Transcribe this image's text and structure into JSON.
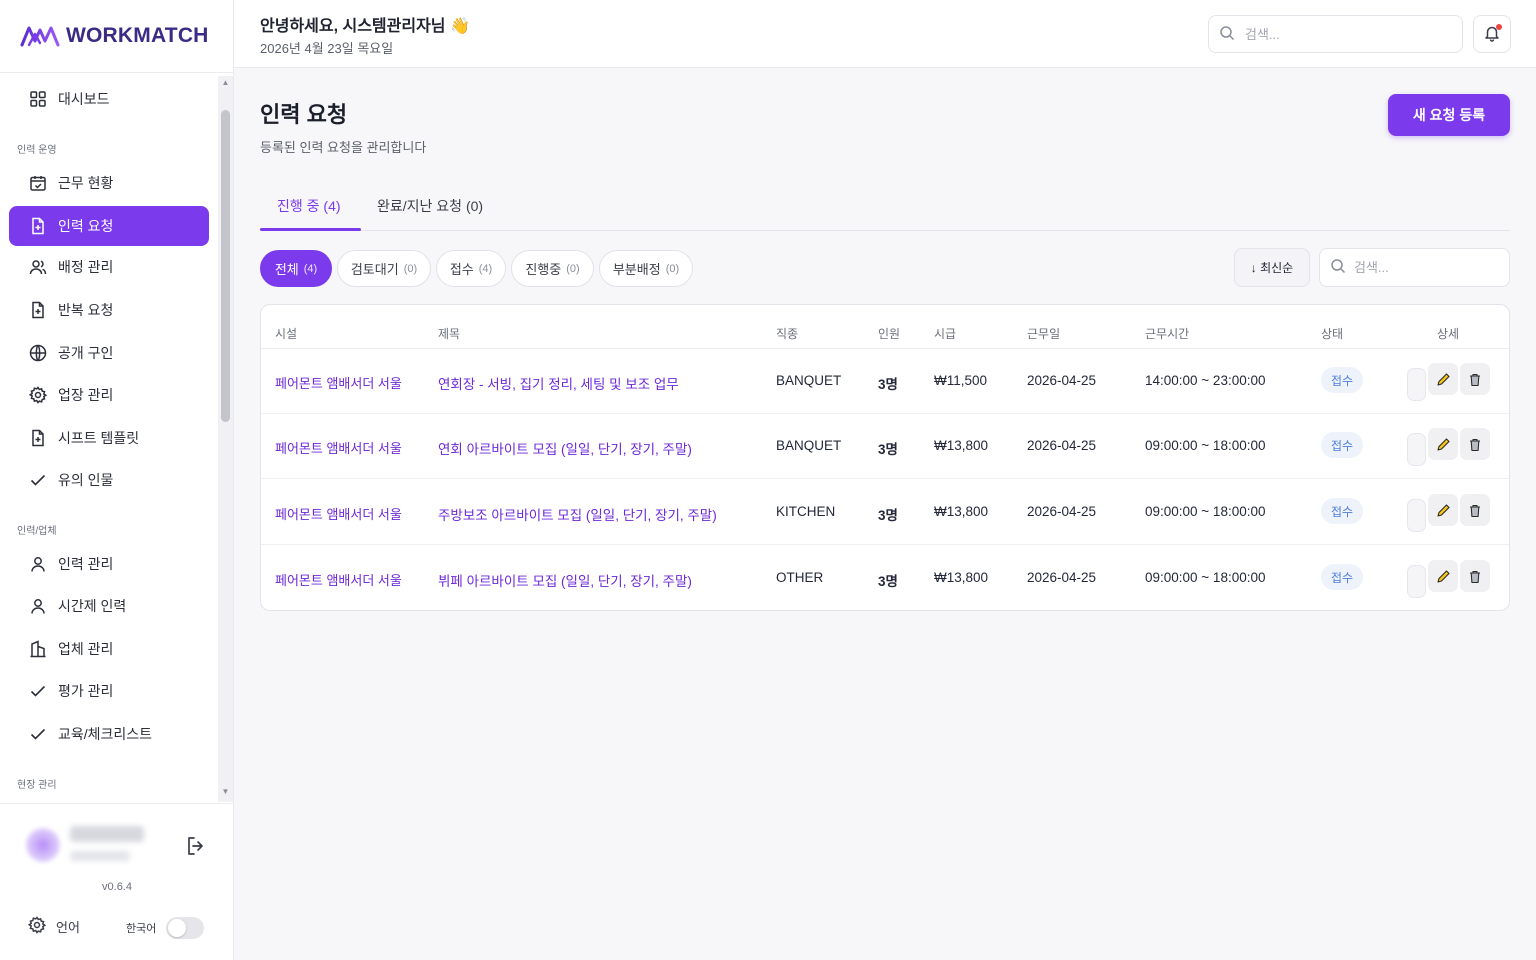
{
  "brand": {
    "name": "WORKMATCH",
    "version": "v0.6.4"
  },
  "sidebar": {
    "items": [
      {
        "label": "대시보드"
      },
      {
        "section": "인력 운영"
      },
      {
        "label": "근무 현황"
      },
      {
        "label": "인력 요청",
        "active": true
      },
      {
        "label": "배정 관리"
      },
      {
        "label": "반복 요청"
      },
      {
        "label": "공개 구인"
      },
      {
        "label": "업장 관리"
      },
      {
        "label": "시프트 템플릿"
      },
      {
        "label": "유의 인물"
      },
      {
        "section": "인력/업체"
      },
      {
        "label": "인력 관리"
      },
      {
        "label": "시간제 인력"
      },
      {
        "label": "업체 관리"
      },
      {
        "label": "평가 관리"
      },
      {
        "label": "교육/체크리스트"
      },
      {
        "section": "현장 관리"
      }
    ],
    "language_label": "언어",
    "language_value": "한국어"
  },
  "header": {
    "greeting": "안녕하세요, 시스템관리자님 👋",
    "date": "2026년 4월 23일 목요일",
    "search_placeholder": "검색..."
  },
  "page": {
    "title": "인력 요청",
    "subtitle": "등록된 인력 요청을 관리합니다",
    "new_button": "새 요청 등록",
    "tabs": [
      {
        "label": "진행 중 (4)",
        "active": true
      },
      {
        "label": "완료/지난 요청 (0)",
        "active": false
      }
    ],
    "filters": [
      {
        "label": "전체",
        "count": "(4)",
        "active": true
      },
      {
        "label": "검토대기",
        "count": "(0)"
      },
      {
        "label": "접수",
        "count": "(4)"
      },
      {
        "label": "진행중",
        "count": "(0)"
      },
      {
        "label": "부분배정",
        "count": "(0)"
      }
    ],
    "sort_label": "↓ 최신순",
    "table_search_placeholder": "검색..."
  },
  "table": {
    "columns": [
      "시설",
      "제목",
      "직종",
      "인원",
      "시급",
      "근무일",
      "근무시간",
      "상태",
      "상세"
    ],
    "rows": [
      {
        "facility": "페어몬트 앰배서더 서울",
        "title": "연회장 - 서빙, 집기 정리, 세팅 및 보조 업무",
        "job": "BANQUET",
        "people": "3명",
        "wage": "₩11,500",
        "date": "2026-04-25",
        "time": "14:00:00 ~ 23:00:00",
        "status": "접수"
      },
      {
        "facility": "페어몬트 앰배서더 서울",
        "title": "연회 아르바이트 모집 (일일, 단기, 장기, 주말)",
        "job": "BANQUET",
        "people": "3명",
        "wage": "₩13,800",
        "date": "2026-04-25",
        "time": "09:00:00 ~ 18:00:00",
        "status": "접수"
      },
      {
        "facility": "페어몬트 앰배서더 서울",
        "title": "주방보조 아르바이트 모집 (일일, 단기, 장기, 주말)",
        "job": "KITCHEN",
        "people": "3명",
        "wage": "₩13,800",
        "date": "2026-04-25",
        "time": "09:00:00 ~ 18:00:00",
        "status": "접수"
      },
      {
        "facility": "페어몬트 앰배서더 서울",
        "title": "뷔페 아르바이트 모집 (일일, 단기, 장기, 주말)",
        "job": "OTHER",
        "people": "3명",
        "wage": "₩13,800",
        "date": "2026-04-25",
        "time": "09:00:00 ~ 18:00:00",
        "status": "접수"
      }
    ]
  },
  "colors": {
    "accent": "#7c3aed",
    "status_bg": "#eef2fb",
    "status_text": "#4f7fd9"
  }
}
